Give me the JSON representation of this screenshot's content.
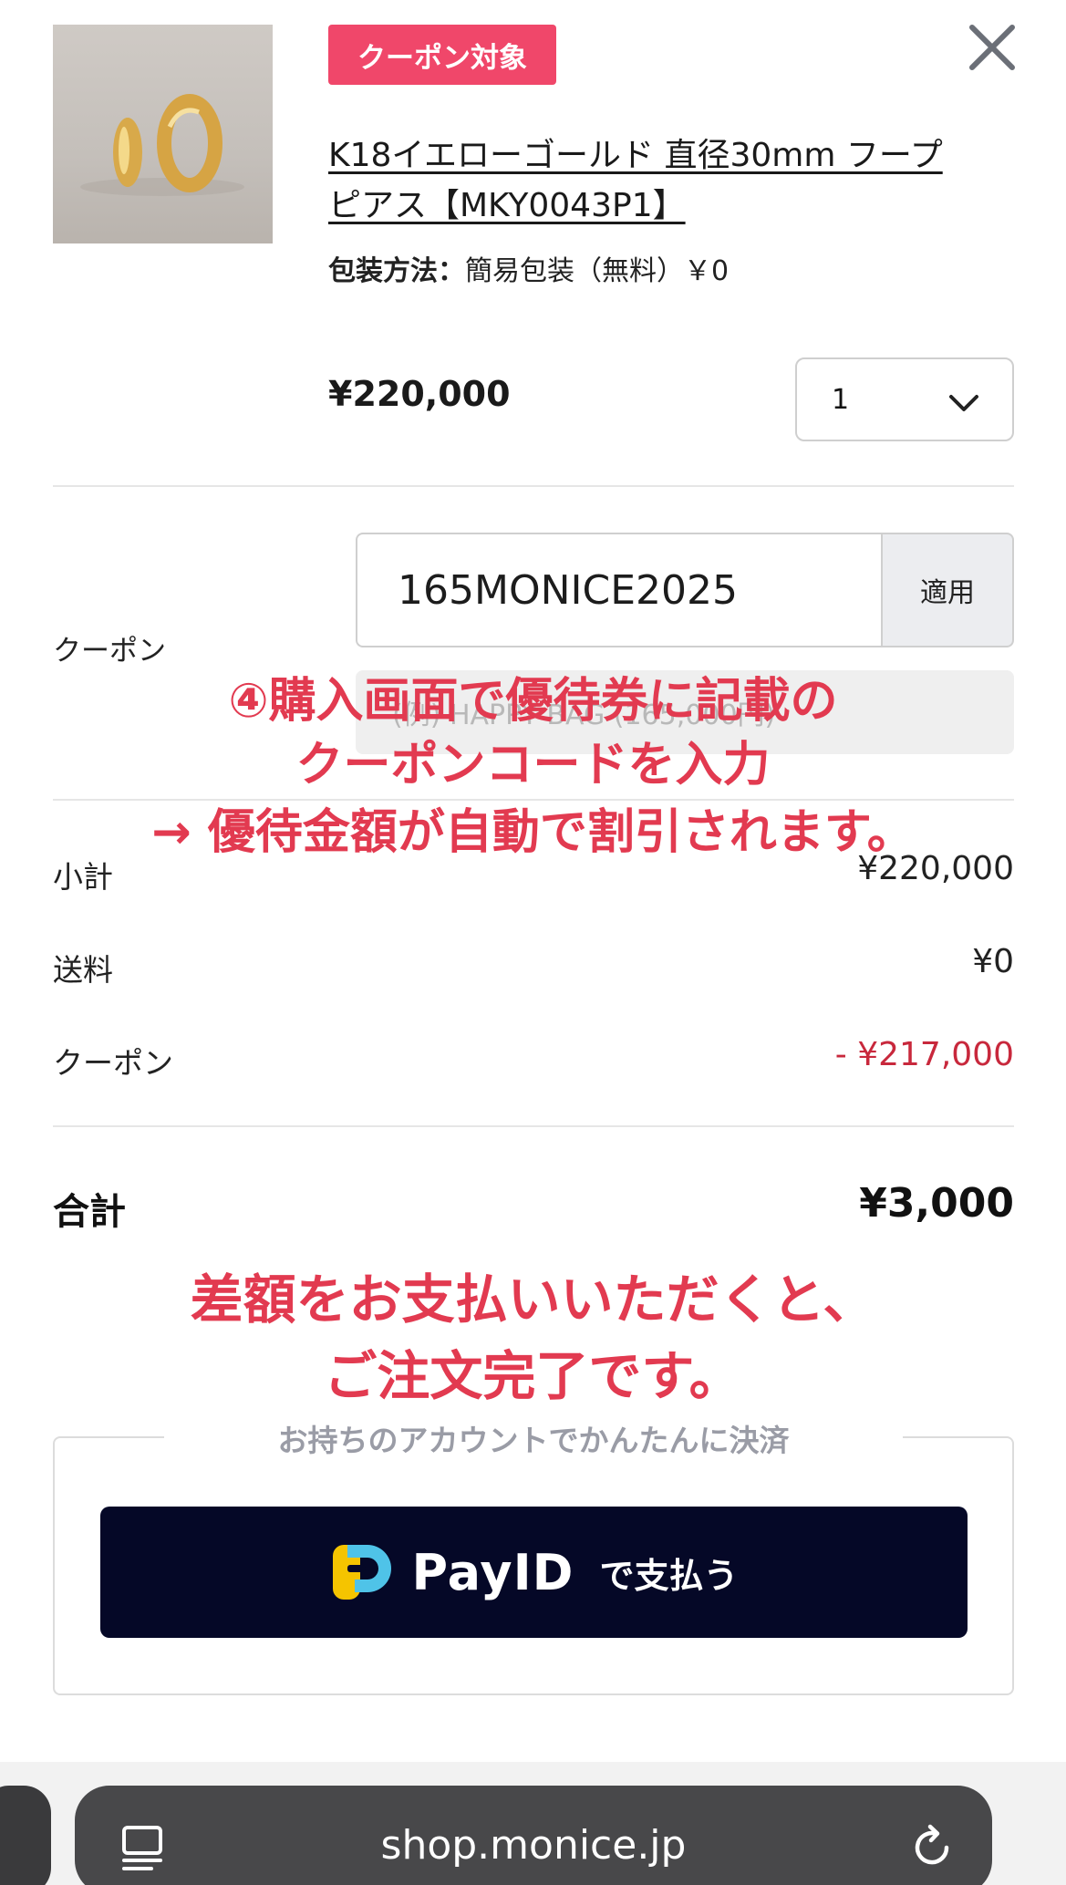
{
  "product": {
    "badge": "クーポン対象",
    "title": "K18イエローゴールド 直径30mm フープピアス【MKY0043P1】",
    "wrapping_label": "包装方法：",
    "wrapping_value": "簡易包装（無料）￥0",
    "price": "¥220,000",
    "quantity": "1"
  },
  "coupon": {
    "label": "クーポン",
    "code": "165MONICE2025",
    "apply_label": "適用",
    "note_placeholder": "(例) HAPPY BAG (165,000円)"
  },
  "annotations": {
    "line1": "④購入画面で優待券に記載の",
    "line2": "クーポンコードを入力",
    "line3": "→ 優待金額が自動で割引されます。",
    "line4": "差額をお支払いいただくと、",
    "line5": "ご注文完了です。"
  },
  "summary": {
    "subtotal_label": "小計",
    "subtotal_value": "¥220,000",
    "shipping_label": "送料",
    "shipping_value": "¥0",
    "coupon_label": "クーポン",
    "coupon_value": "- ¥217,000",
    "total_label": "合計",
    "total_value": "¥3,000"
  },
  "payment": {
    "caption": "お持ちのアカウントでかんたんに決済",
    "brand": "PayID",
    "button_suffix": "で支払う"
  },
  "browser": {
    "url": "shop.monice.jp"
  },
  "colors": {
    "badge": "#f0476a",
    "annotation": "#e23a50",
    "discount": "#c8283c",
    "pay_button": "#050827"
  },
  "icons": [
    "close-icon",
    "chevron-down-icon",
    "payid-logo-icon",
    "reader-icon",
    "reload-icon"
  ]
}
